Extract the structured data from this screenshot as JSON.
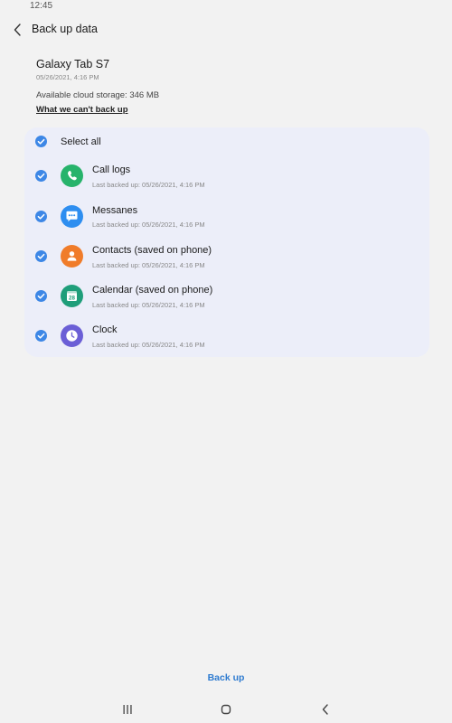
{
  "status_bar": {
    "time": "12:45"
  },
  "header": {
    "back_icon": "chevron-left-icon",
    "title": "Back up data"
  },
  "device": {
    "name": "Galaxy Tab S7",
    "date": "05/26/2021, 4:16 PM",
    "storage": "Available cloud storage: 346 MB",
    "cant_backup_link": "What we can't back up"
  },
  "select_all": {
    "label": "Select all",
    "checked": true
  },
  "items": [
    {
      "label": "Call logs",
      "sub": "Last backed up: 05/26/2021, 4:16 PM",
      "icon": "phone-icon",
      "color": "#27b36b",
      "checked": true
    },
    {
      "label": "Messanes",
      "sub": "Last backed up: 05/26/2021, 4:16 PM",
      "icon": "message-icon",
      "color": "#2e8ef0",
      "checked": true
    },
    {
      "label": "Contacts (saved on phone)",
      "sub": "Last backed up: 05/26/2021, 4:16 PM",
      "icon": "contact-icon",
      "color": "#f07c2a",
      "checked": true
    },
    {
      "label": "Calendar (saved on phone)",
      "sub": "Last backed up: 05/26/2021, 4:16 PM",
      "icon": "calendar-icon",
      "color": "#1f9e7a",
      "calendar_day": "28",
      "checked": true
    },
    {
      "label": "Clock",
      "sub": "Last backed up: 05/26/2021, 4:16 PM",
      "icon": "clock-icon",
      "color": "#6b5fd6",
      "checked": true
    }
  ],
  "footer": {
    "backup_label": "Back up"
  },
  "nav": {
    "recents_icon": "recents-icon",
    "home_icon": "home-icon",
    "back_icon": "back-icon"
  },
  "colors": {
    "accent": "#3d87e6",
    "link": "#2e7bd0",
    "card_bg": "#eceef9",
    "page_bg": "#f2f2f2"
  }
}
